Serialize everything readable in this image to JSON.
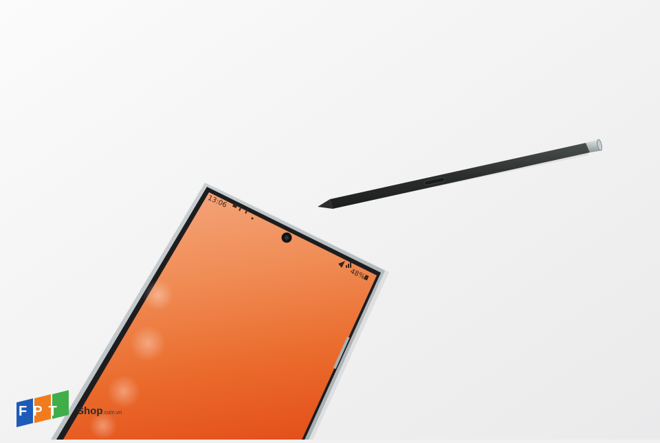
{
  "phone": {
    "status_bar": {
      "time": "13:06",
      "battery": "48%"
    }
  },
  "watermark": {
    "brand": "FPT",
    "shop": "Shop",
    "domain": ".com.vn"
  },
  "colors": {
    "background": "#f1f1f2",
    "screen_top": "#f3a57a",
    "screen_bottom": "#e8531a",
    "stylus_body": "#2e3130",
    "stylus_cap": "#b9c2c4",
    "fpt_blue": "#1e5bb8",
    "fpt_orange": "#f07c1e",
    "fpt_green": "#3fae49"
  }
}
